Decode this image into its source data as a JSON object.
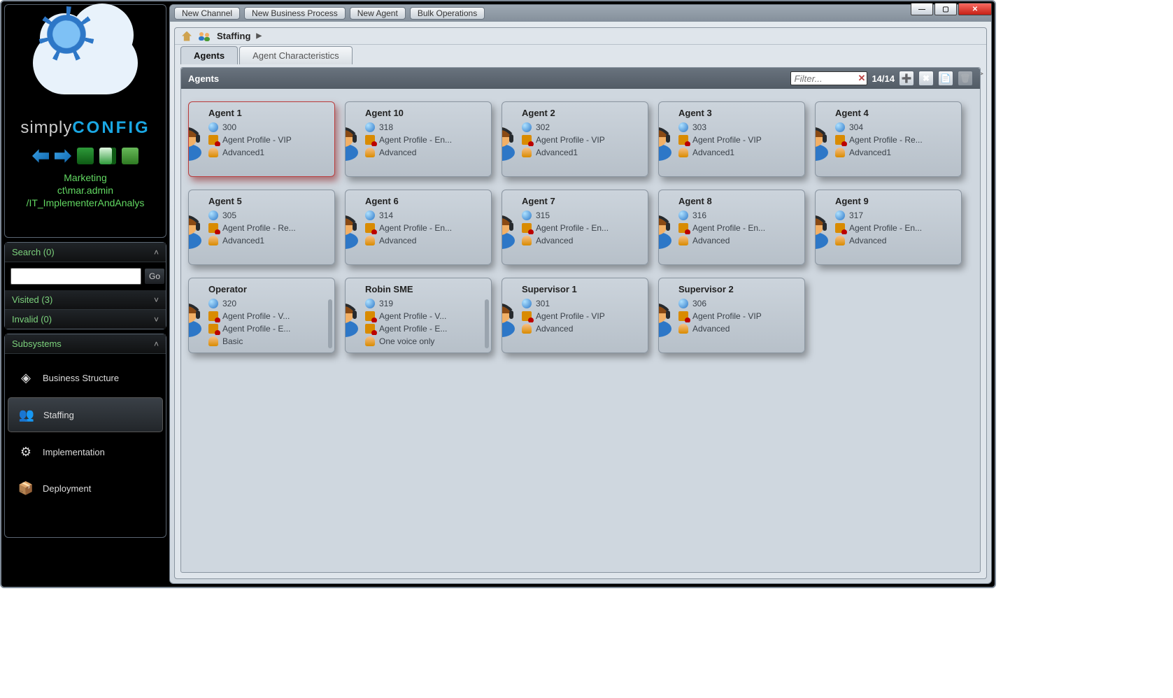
{
  "window": {
    "min": "—",
    "max": "▢",
    "close": "✕"
  },
  "brand": {
    "a": "simply",
    "b": "CONFIG"
  },
  "tenant": {
    "l1": "Marketing",
    "l2": "ct\\mar.admin",
    "l3": "/IT_ImplementerAndAnalys"
  },
  "toolbar": {
    "new_channel": "New Channel",
    "new_bp": "New Business Process",
    "new_agent": "New Agent",
    "bulk_ops": "Bulk Operations"
  },
  "breadcrumb": {
    "label": "Staffing",
    "arrow": "▶"
  },
  "tabs": {
    "agents": "Agents",
    "agent_chars": "Agent Characteristics"
  },
  "panel": {
    "title": "Agents",
    "filter_placeholder": "Filter...",
    "count": "14/14"
  },
  "search": {
    "title": "Search (0)",
    "go": "Go"
  },
  "visited": {
    "title": "Visited (3)"
  },
  "invalid": {
    "title": "Invalid (0)"
  },
  "subsystems": {
    "title": "Subsystems",
    "items": [
      {
        "label": "Business Structure",
        "icon": "◈"
      },
      {
        "label": "Staffing",
        "icon": "👥"
      },
      {
        "label": "Implementation",
        "icon": "⚙"
      },
      {
        "label": "Deployment",
        "icon": "📦"
      }
    ]
  },
  "agents": [
    {
      "name": "Agent 1",
      "ext": "300",
      "profile": "Agent Profile - VIP",
      "group": "Advanced1",
      "selected": true
    },
    {
      "name": "Agent 10",
      "ext": "318",
      "profile": "Agent Profile - En...",
      "group": "Advanced"
    },
    {
      "name": "Agent 2",
      "ext": "302",
      "profile": "Agent Profile - VIP",
      "group": "Advanced1"
    },
    {
      "name": "Agent 3",
      "ext": "303",
      "profile": "Agent Profile - VIP",
      "group": "Advanced1"
    },
    {
      "name": "Agent 4",
      "ext": "304",
      "profile": "Agent Profile - Re...",
      "group": "Advanced1"
    },
    {
      "name": "Agent 5",
      "ext": "305",
      "profile": "Agent Profile - Re...",
      "group": "Advanced1"
    },
    {
      "name": "Agent 6",
      "ext": "314",
      "profile": "Agent Profile - En...",
      "group": "Advanced"
    },
    {
      "name": "Agent 7",
      "ext": "315",
      "profile": "Agent Profile - En...",
      "group": "Advanced"
    },
    {
      "name": "Agent 8",
      "ext": "316",
      "profile": "Agent Profile - En...",
      "group": "Advanced"
    },
    {
      "name": "Agent 9",
      "ext": "317",
      "profile": "Agent Profile - En...",
      "group": "Advanced"
    },
    {
      "name": "Operator",
      "ext": "320",
      "profile": "Agent Profile - V...",
      "profile2": "Agent Profile - E...",
      "group": "Basic",
      "scroll": true
    },
    {
      "name": "Robin SME",
      "ext": "319",
      "profile": "Agent Profile - V...",
      "profile2": "Agent Profile - E...",
      "group": "One voice only",
      "scroll": true
    },
    {
      "name": "Supervisor 1",
      "ext": "301",
      "profile": "Agent Profile - VIP",
      "group": "Advanced"
    },
    {
      "name": "Supervisor 2",
      "ext": "306",
      "profile": "Agent Profile - VIP",
      "group": "Advanced"
    }
  ]
}
